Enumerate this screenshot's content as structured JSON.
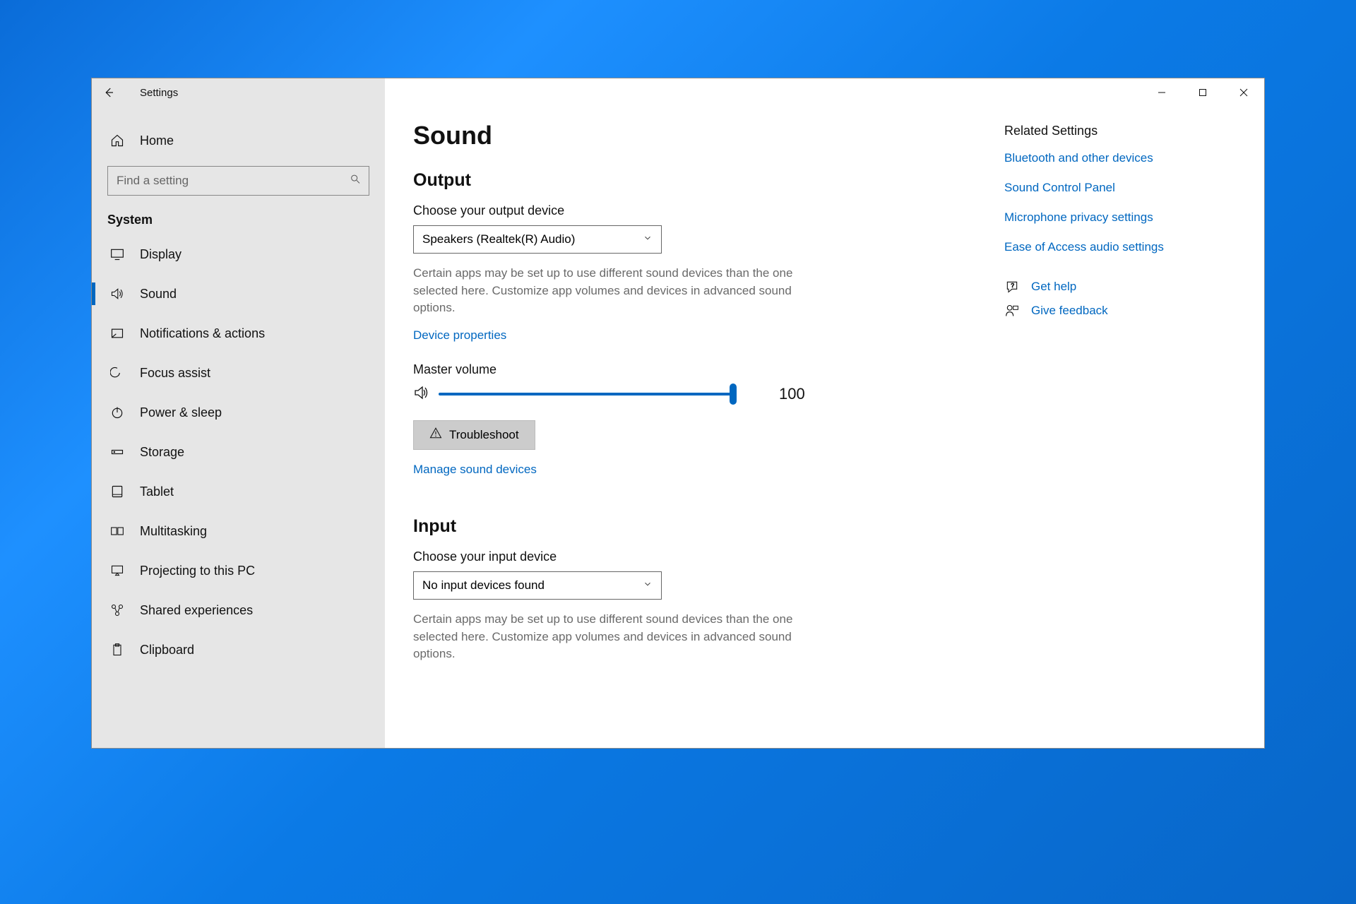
{
  "window": {
    "title": "Settings"
  },
  "sidebar": {
    "home_label": "Home",
    "search_placeholder": "Find a setting",
    "section_label": "System",
    "items": [
      {
        "label": "Display"
      },
      {
        "label": "Sound"
      },
      {
        "label": "Notifications & actions"
      },
      {
        "label": "Focus assist"
      },
      {
        "label": "Power & sleep"
      },
      {
        "label": "Storage"
      },
      {
        "label": "Tablet"
      },
      {
        "label": "Multitasking"
      },
      {
        "label": "Projecting to this PC"
      },
      {
        "label": "Shared experiences"
      },
      {
        "label": "Clipboard"
      }
    ],
    "active_index": 1
  },
  "main": {
    "page_title": "Sound",
    "output": {
      "heading": "Output",
      "choose_label": "Choose your output device",
      "selected_device": "Speakers (Realtek(R) Audio)",
      "helper": "Certain apps may be set up to use different sound devices than the one selected here. Customize app volumes and devices in advanced sound options.",
      "device_properties": "Device properties",
      "master_volume_label": "Master volume",
      "master_volume_value": "100",
      "troubleshoot": "Troubleshoot",
      "manage_link": "Manage sound devices"
    },
    "input": {
      "heading": "Input",
      "choose_label": "Choose your input device",
      "selected_device": "No input devices found",
      "helper": "Certain apps may be set up to use different sound devices than the one selected here. Customize app volumes and devices in advanced sound options."
    }
  },
  "right": {
    "heading": "Related Settings",
    "links": [
      "Bluetooth and other devices",
      "Sound Control Panel",
      "Microphone privacy settings",
      "Ease of Access audio settings"
    ],
    "help": "Get help",
    "feedback": "Give feedback"
  }
}
